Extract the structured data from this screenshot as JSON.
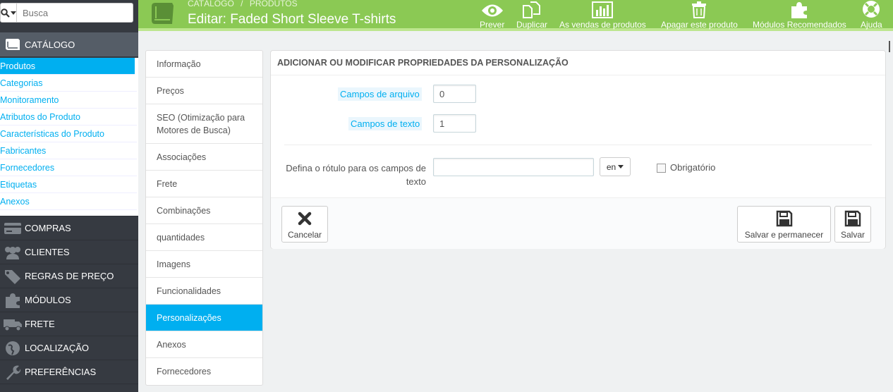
{
  "search": {
    "placeholder": "Busca"
  },
  "sidebar": {
    "catalog_label": "CATÁLOGO",
    "catalog_items": [
      {
        "label": "Produtos"
      },
      {
        "label": "Categorias"
      },
      {
        "label": "Monitoramento"
      },
      {
        "label": "Atributos do Produto"
      },
      {
        "label": "Características do Produto"
      },
      {
        "label": "Fabricantes"
      },
      {
        "label": "Fornecedores"
      },
      {
        "label": "Etiquetas"
      },
      {
        "label": "Anexos"
      }
    ],
    "menus": [
      {
        "label": "COMPRAS",
        "icon": "credit-card-icon"
      },
      {
        "label": "CLIENTES",
        "icon": "users-icon"
      },
      {
        "label": "REGRAS DE PREÇO",
        "icon": "tags-icon"
      },
      {
        "label": "MÓDULOS",
        "icon": "puzzle-icon"
      },
      {
        "label": "FRETE",
        "icon": "truck-icon"
      },
      {
        "label": "LOCALIZAÇÃO",
        "icon": "globe-icon"
      },
      {
        "label": "PREFERÊNCIAS",
        "icon": "wrench-icon"
      }
    ]
  },
  "header": {
    "breadcrumb_1": "CATÁLOGO",
    "breadcrumb_sep": "/",
    "breadcrumb_2": "PRODUTOS",
    "title": "Editar: Faded Short Sleeve T-shirts",
    "toolbar": {
      "preview": "Prever",
      "duplicate": "Duplicar",
      "sales": "As vendas de produtos",
      "delete": "Apagar este produto",
      "modules": "Módulos Recomendados",
      "help": "Ajuda"
    }
  },
  "tabs": [
    {
      "label": "Informação"
    },
    {
      "label": "Preços"
    },
    {
      "label": "SEO (Otimização para Motores de Busca)"
    },
    {
      "label": "Associações"
    },
    {
      "label": "Frete"
    },
    {
      "label": "Combinações"
    },
    {
      "label": "quantidades"
    },
    {
      "label": "Imagens"
    },
    {
      "label": "Funcionalidades"
    },
    {
      "label": "Personalizações"
    },
    {
      "label": "Anexos"
    },
    {
      "label": "Fornecedores"
    }
  ],
  "panel": {
    "title": "ADICIONAR OU MODIFICAR PROPRIEDADES DA PERSONALIZAÇÃO",
    "file_fields_label": "Campos de arquivo",
    "file_fields_value": "0",
    "text_fields_label": "Campos de texto",
    "text_fields_value": "1",
    "label_def_text": "Defina o rótulo para os campos de texto",
    "label_value": "",
    "language": "en",
    "required_label": "Obrigatório",
    "cancel": "Cancelar",
    "save_stay": "Salvar e permanecer",
    "save": "Salvar"
  },
  "colors": {
    "accent": "#00aff0",
    "header": "#8bc954",
    "sidebar": "#363a41"
  }
}
